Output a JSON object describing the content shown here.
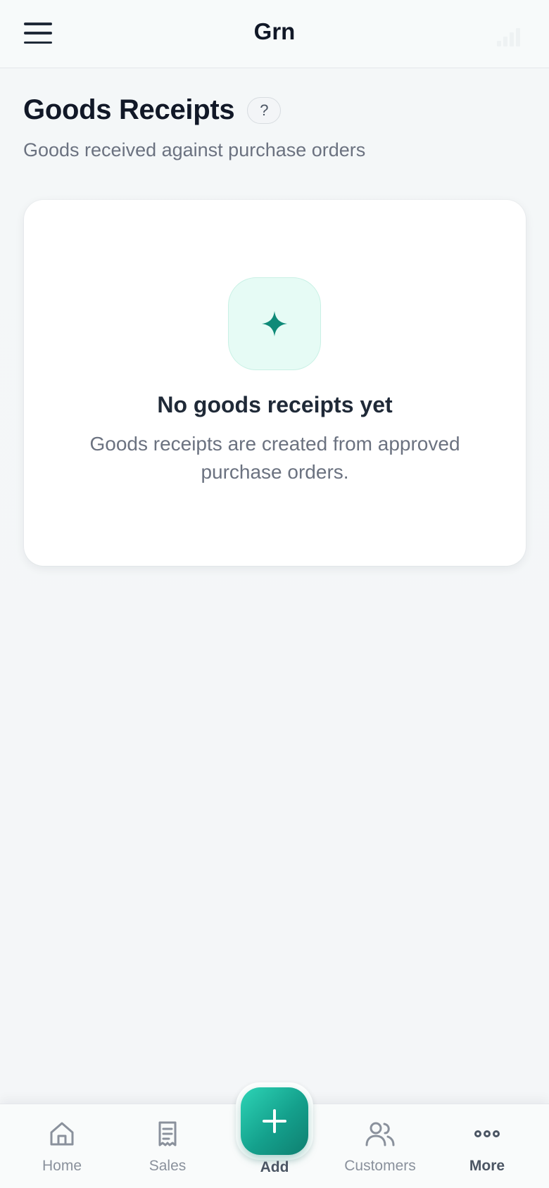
{
  "header": {
    "title": "Grn",
    "menu_icon": "hamburger-menu-icon",
    "status_icon": "signal-bars-icon"
  },
  "page": {
    "title": "Goods Receipts",
    "help_label": "?",
    "subtitle": "Goods received against purchase orders"
  },
  "empty_state": {
    "icon": "sparkle-icon",
    "title": "No goods receipts yet",
    "description": "Goods receipts are created from approved purchase orders."
  },
  "bottom_nav": {
    "items": [
      {
        "label": "Home",
        "icon": "home-icon"
      },
      {
        "label": "Sales",
        "icon": "receipt-icon"
      },
      {
        "label": "Add",
        "icon": "plus-icon"
      },
      {
        "label": "Customers",
        "icon": "users-icon"
      },
      {
        "label": "More",
        "icon": "more-dots-icon"
      }
    ]
  },
  "colors": {
    "accent": "#14a08c",
    "accent_light": "#e6fbf5",
    "text_primary": "#111827",
    "text_muted": "#6b7280"
  }
}
